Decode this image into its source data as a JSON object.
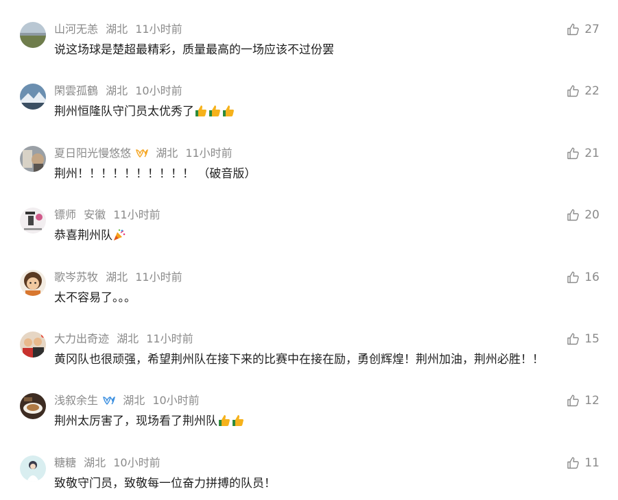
{
  "comments": [
    {
      "user": "山河无恙",
      "location": "湖北",
      "time": "11小时前",
      "text": "说这场球是楚超最精彩，质量最高的一场应该不过份罢",
      "likes": "27"
    },
    {
      "user": "閑雲孤鶴",
      "location": "湖北",
      "time": "10小时前",
      "text": "荆州恒隆队守门员太优秀了",
      "likes": "22"
    },
    {
      "user": "夏日阳光慢悠悠",
      "location": "湖北",
      "time": "11小时前",
      "text": "荆州！！！！！！！！！！  （破音版）",
      "likes": "21"
    },
    {
      "user": "镖师",
      "location": "安徽",
      "time": "11小时前",
      "text": "恭喜荆州队",
      "likes": "20"
    },
    {
      "user": "歌岑苏牧",
      "location": "湖北",
      "time": "11小时前",
      "text": "太不容易了。。。",
      "likes": "16"
    },
    {
      "user": "大力出奇迹",
      "location": "湖北",
      "time": "11小时前",
      "text": "黄冈队也很顽强，希望荆州队在接下来的比赛中在接在励，勇创辉煌！荆州加油，荆州必胜！！",
      "likes": "15"
    },
    {
      "user": "浅叙余生",
      "location": "湖北",
      "time": "10小时前",
      "text": "荆州太厉害了，现场看了荆州队",
      "likes": "12"
    },
    {
      "user": "糖糖",
      "location": "湖北",
      "time": "10小时前",
      "text": "致敬守门员，致敬每一位奋力拼搏的队员！",
      "likes": "11"
    }
  ]
}
